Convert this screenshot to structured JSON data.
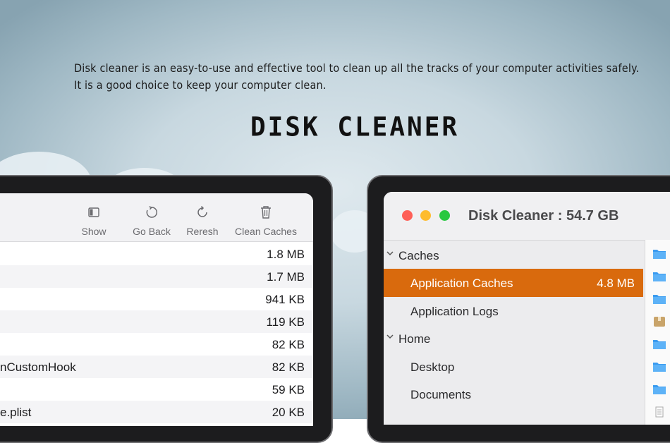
{
  "marketing": {
    "tagline_1": "Disk cleaner is an easy-to-use and effective tool to clean up all the tracks of your computer activities safely.",
    "tagline_2": "It is a good choice to keep your computer clean.",
    "brand": "DISK CLEANER"
  },
  "left_window": {
    "toolbar": [
      {
        "label": "Show",
        "icon": "sidebar-icon"
      },
      {
        "label": "Go Back",
        "icon": "undo-circle-icon"
      },
      {
        "label": "Reresh",
        "icon": "refresh-icon"
      },
      {
        "label": "Clean Caches",
        "icon": "trash-icon"
      }
    ],
    "rows": [
      {
        "name": "",
        "size": "1.8 MB"
      },
      {
        "name": "",
        "size": "1.7 MB"
      },
      {
        "name": "",
        "size": "941 KB"
      },
      {
        "name": "",
        "size": "119 KB"
      },
      {
        "name": "",
        "size": "82 KB"
      },
      {
        "name": "nCustomHook",
        "size": "82 KB"
      },
      {
        "name": "",
        "size": "59 KB"
      },
      {
        "name": "e.plist",
        "size": "20 KB"
      }
    ]
  },
  "right_window": {
    "title": "Disk Cleaner : 54.7 GB",
    "sidebar": [
      {
        "label": "Caches",
        "type": "group",
        "value": ""
      },
      {
        "label": "Application Caches",
        "type": "item",
        "selected": true,
        "value": "4.8 MB"
      },
      {
        "label": "Application Logs",
        "type": "item",
        "value": ""
      },
      {
        "label": "Home",
        "type": "group",
        "value": ""
      },
      {
        "label": "Desktop",
        "type": "item",
        "value": ""
      },
      {
        "label": "Documents",
        "type": "item",
        "value": ""
      }
    ],
    "colors": {
      "selected": "#d96a0d",
      "close": "#fe5f57",
      "minimize": "#febc2e",
      "zoom": "#28c840"
    }
  }
}
